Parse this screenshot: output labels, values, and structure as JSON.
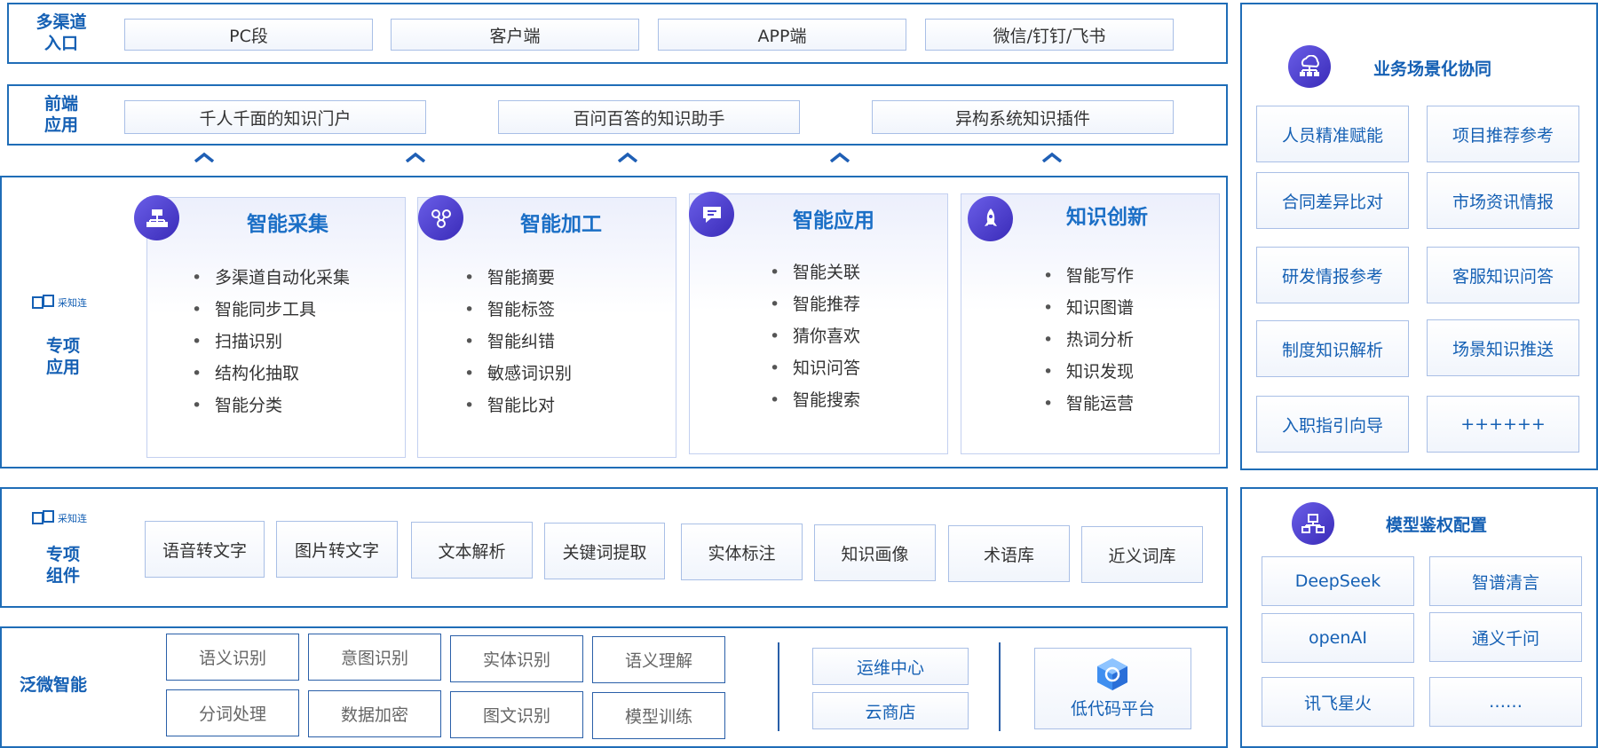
{
  "rows": {
    "entry": "多渠道\n入口",
    "frontend": "前端\n应用",
    "special_app": "专项\n应用",
    "special_comp": "专项\n组件",
    "base": "泛微智能"
  },
  "entry_items": [
    "PC段",
    "客户端",
    "APP端",
    "微信/钉钉/飞书"
  ],
  "frontend_items": [
    "千人千面的知识门户",
    "百问百答的知识助手",
    "异构系统知识插件"
  ],
  "logo_text": "采知连",
  "cards": [
    {
      "title": "智能采集",
      "items": [
        "多渠道自动化采集",
        "智能同步工具",
        "扫描识别",
        "结构化抽取",
        "智能分类"
      ]
    },
    {
      "title": "智能加工",
      "items": [
        "智能摘要",
        "智能标签",
        "智能纠错",
        "敏感词识别",
        "智能比对"
      ]
    },
    {
      "title": "智能应用",
      "items": [
        "智能关联",
        "智能推荐",
        "猜你喜欢",
        "知识问答",
        "智能搜索"
      ]
    },
    {
      "title": "知识创新",
      "items": [
        "智能写作",
        "知识图谱",
        "热词分析",
        "知识发现",
        "智能运营"
      ]
    }
  ],
  "components": [
    "语音转文字",
    "图片转文字",
    "文本解析",
    "关键词提取",
    "实体标注",
    "知识画像",
    "术语库",
    "近义词库"
  ],
  "base_items": [
    "语义识别",
    "意图识别",
    "实体识别",
    "语义理解",
    "分词处理",
    "数据加密",
    "图文识别",
    "模型训练"
  ],
  "ops": [
    "运维中心",
    "云商店"
  ],
  "lowcode": "低代码平台",
  "scenario": {
    "title": "业务场景化协同",
    "items": [
      "人员精准赋能",
      "项目推荐参考",
      "合同差异比对",
      "市场资讯情报",
      "研发情报参考",
      "客服知识问答",
      "制度知识解析",
      "场景知识推送",
      "入职指引向导",
      "++++++"
    ]
  },
  "models": {
    "title": "模型鉴权配置",
    "items": [
      "DeepSeek",
      "智谱清言",
      "openAI",
      "通义千问",
      "讯飞星火",
      "……"
    ]
  },
  "colors": {
    "accent": "#1560b4",
    "frame": "#1f6db7",
    "box_border": "#a9bfe6",
    "icon": "#4b3fd0"
  }
}
